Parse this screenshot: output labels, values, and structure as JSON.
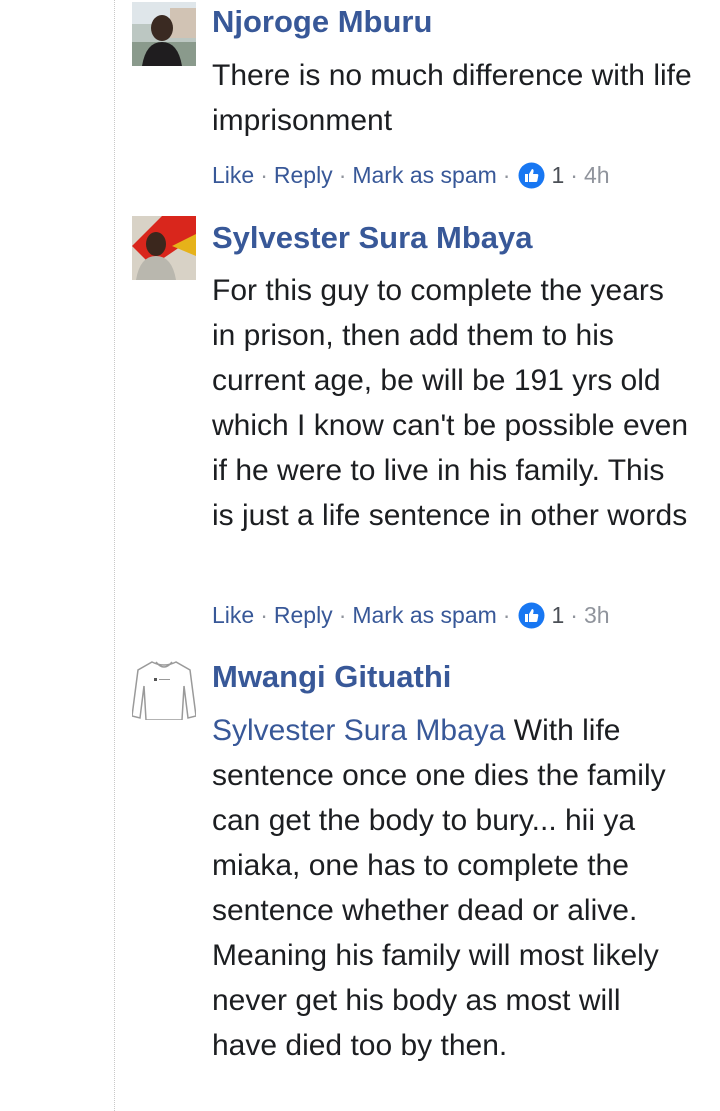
{
  "comments": [
    {
      "author": "Njoroge Mburu",
      "avatar": "person-photo-avatar",
      "text": "There is no much difference with life imprisonment",
      "actions": {
        "like": "Like",
        "reply": "Reply",
        "spam": "Mark as spam"
      },
      "reaction_icon": "thumbs-up-icon",
      "reaction_count": "1",
      "time": "4h"
    },
    {
      "author": "Sylvester Sura Mbaya",
      "avatar": "person-photo-avatar",
      "text": "For this guy to complete the years in prison, then add them to his current age, be will be 191 yrs old which I know can't be possible even if he were to live in his family. This is just a life sentence in other words",
      "actions": {
        "like": "Like",
        "reply": "Reply",
        "spam": "Mark as spam"
      },
      "reaction_icon": "thumbs-up-icon",
      "reaction_count": "1",
      "time": "3h"
    },
    {
      "author": "Mwangi Gituathi",
      "avatar": "shirt-sketch-avatar",
      "mention": "Sylvester Sura Mbaya",
      "text": " With life sentence once one dies the family can get the body to bury... hii ya miaka, one has to complete the sentence whether dead or alive. Meaning his family will most likely never get his body as most will have died too by then."
    }
  ],
  "colors": {
    "author": "#385898",
    "text": "#1c1e21",
    "meta": "#90949c",
    "like_badge": "#1877f2"
  },
  "separator": "·"
}
